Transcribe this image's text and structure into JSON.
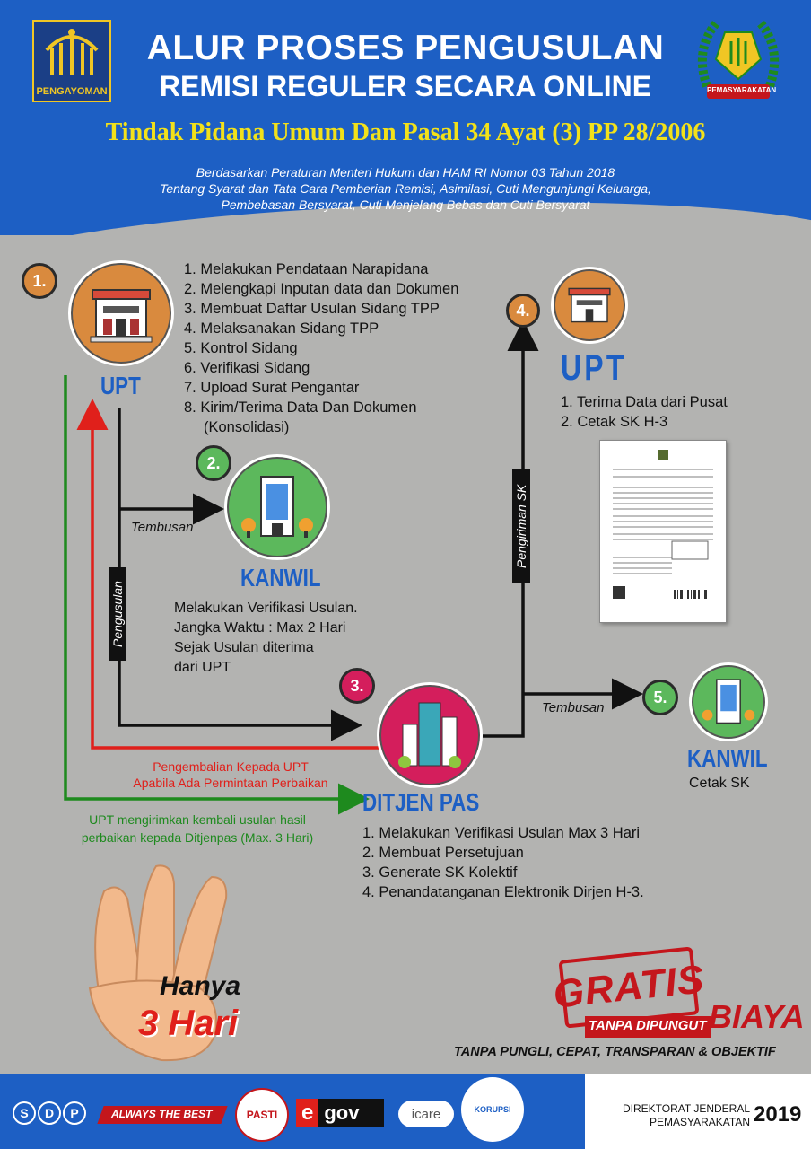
{
  "header": {
    "title_line1": "ALUR PROSES PENGUSULAN",
    "title_line2": "REMISI REGULER SECARA ONLINE",
    "subtitle": "Tindak Pidana Umum Dan Pasal 34 Ayat (3) PP 28/2006",
    "basis_line1": "Berdasarkan Peraturan Menteri Hukum dan HAM RI Nomor 03 Tahun 2018",
    "basis_line2": "Tentang Syarat dan Tata Cara Pemberian Remisi, Asimilasi, Cuti Mengunjungi Keluarga,",
    "basis_line3": "Pembebasan Bersyarat, Cuti Menjelang Bebas dan Cuti Bersyarat",
    "logo_left_text": "PENGAYOMAN",
    "logo_right_text": "PEMASYARAKATAN"
  },
  "step1": {
    "number": "1.",
    "label": "UPT",
    "items": [
      "1. Melakukan Pendataan Narapidana",
      "2. Melengkapi Inputan data dan Dokumen",
      "3. Membuat Daftar Usulan Sidang TPP",
      "4. Melaksanakan Sidang TPP",
      "5. Kontrol Sidang",
      "6. Verifikasi Sidang",
      "7. Upload Surat Pengantar",
      "8. Kirim/Terima Data Dan Dokumen",
      "(Konsolidasi)"
    ]
  },
  "step2": {
    "number": "2.",
    "label": "KANWIL",
    "desc_line1": "Melakukan Verifikasi Usulan.",
    "desc_line2": "Jangka Waktu : Max 2 Hari",
    "desc_line3": "Sejak Usulan diterima",
    "desc_line4": "dari UPT"
  },
  "step3": {
    "number": "3.",
    "label": "DITJEN PAS",
    "items": [
      "1. Melakukan Verifikasi Usulan Max 3 Hari",
      "2. Membuat Persetujuan",
      "3. Generate SK Kolektif",
      "4. Penandatanganan Elektronik Dirjen H-3."
    ]
  },
  "step4": {
    "number": "4.",
    "label": "UPT",
    "items": [
      "1. Terima Data dari Pusat",
      "2. Cetak SK H-3"
    ]
  },
  "step5": {
    "number": "5.",
    "label": "KANWIL",
    "desc": "Cetak SK"
  },
  "arrows": {
    "tembusan1": "Tembusan",
    "pengusulan": "Pengusulan",
    "pengiriman_sk": "Pengiriman SK",
    "tembusan2": "Tembusan",
    "return_line1": "Pengembalian Kepada UPT",
    "return_line2": "Apabila Ada Permintaan Perbaikan",
    "resend_line1": "UPT mengirimkan kembali usulan hasil",
    "resend_line2": "perbaikan kepada Ditjenpas (Max. 3 Hari)"
  },
  "hand": {
    "line1": "Hanya",
    "line2": "3 Hari"
  },
  "gratis": {
    "stamp": "GRATIS",
    "line1": "TANPA DIPUNGUT",
    "line2": "BIAYA",
    "tagline": "TANPA PUNGLI, CEPAT, TRANSPARAN & OBJEKTIF"
  },
  "footer": {
    "sdp": "SDP",
    "always": "ALWAYS THE BEST",
    "pasti": "PASTI",
    "egov_e": "e",
    "egov_gov": "gov",
    "icare": "icare",
    "wbk": "KORUPSI",
    "org_line1": "DIREKTORAT JENDERAL",
    "org_line2": "PEMASYARAKATAN",
    "year": "2019"
  },
  "colors": {
    "blue": "#1d5fc4",
    "yellow": "#f2e11a",
    "orange": "#d98a3e",
    "green": "#5cb85c",
    "magenta": "#d41e5c",
    "red": "#e0201b",
    "dark_green": "#1e8a1e"
  }
}
